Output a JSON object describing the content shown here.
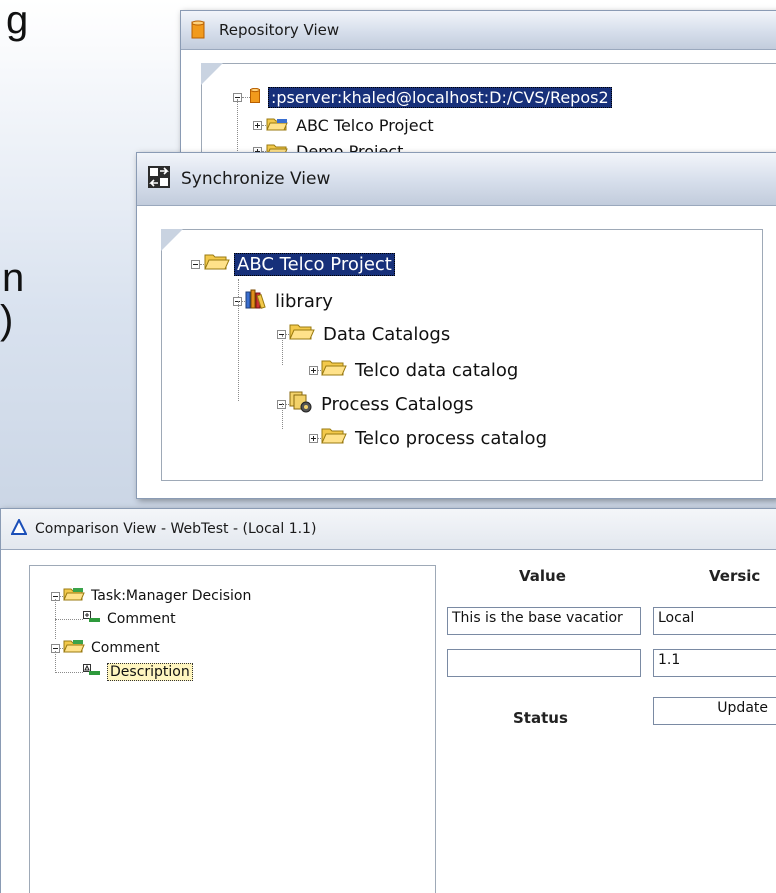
{
  "background": {
    "text_top": "g",
    "text_mid": "n",
    "text_paren": ")"
  },
  "repository_view": {
    "title": "Repository View",
    "tree": {
      "root": ":pserver:khaled@localhost:D:/CVS/Repos2",
      "items": [
        "ABC Telco Project",
        "Demo Project"
      ]
    }
  },
  "synchronize_view": {
    "title": "Synchronize View",
    "tree": {
      "root": "ABC Telco Project",
      "library": "library",
      "data_catalogs": "Data Catalogs",
      "telco_data_catalog": "Telco data catalog",
      "process_catalogs": "Process Catalogs",
      "telco_process_catalog": "Telco process catalog"
    }
  },
  "comparison_view": {
    "title": "Comparison View - WebTest - (Local  1.1)",
    "tree": {
      "task": "Task:Manager Decision",
      "task_comment": "Comment",
      "comment": "Comment",
      "description": "Description"
    },
    "headers": {
      "value": "Value",
      "version": "Versic"
    },
    "rows": [
      {
        "value": "This is the base vacatior",
        "version": "Local"
      },
      {
        "value": "",
        "version": "1.1"
      }
    ],
    "status_label": "Status",
    "status_value": "Update"
  },
  "colors": {
    "selection_dark": "#17307a",
    "selection_light": "#fff6c0",
    "title_gradient_mid": "#d6deeb"
  }
}
